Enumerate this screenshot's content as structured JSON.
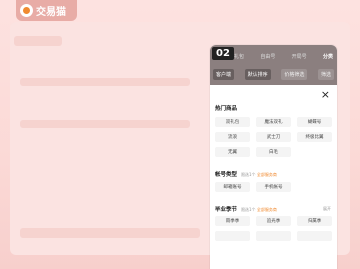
{
  "brand": {
    "name": "交易猫"
  },
  "phone": {
    "step": "02",
    "tabs": [
      "礼包",
      "自由号",
      "开局号",
      "分类"
    ],
    "active_tab": "分类",
    "filters": [
      "客户端",
      "默认排序",
      "价格筛选",
      "筛选"
    ],
    "close_label": "×",
    "sections": {
      "hot": {
        "title": "热门商品",
        "items": [
          "双礼包",
          "魔法双礼",
          "蝴蝶号",
          "流浪",
          "武士刀",
          "终极比翼",
          "无翼",
          "白毛"
        ]
      },
      "account_type": {
        "title": "帐号类型",
        "hint_prefix": "限选1个",
        "hint_link": "全部服务商",
        "items": [
          "邮箱账号",
          "手机帐号"
        ]
      },
      "season": {
        "title": "毕业季节",
        "hint_prefix": "限选1个",
        "hint_link": "全部服务商",
        "more": "展开",
        "items": [
          "雨季季",
          "追光季",
          "归属季"
        ]
      }
    }
  }
}
